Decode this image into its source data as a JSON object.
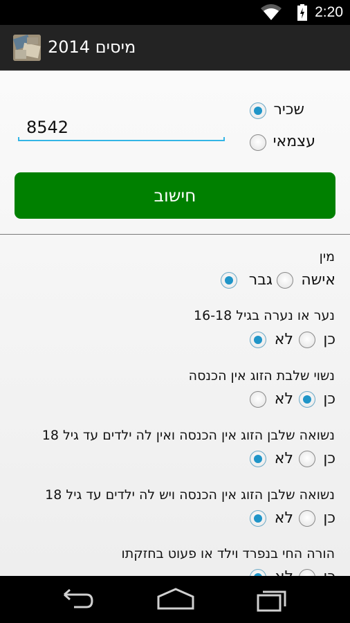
{
  "status_bar": {
    "time": "2:20"
  },
  "app": {
    "title": "מיסים 2014"
  },
  "form": {
    "salary_value": "8542",
    "employment_options": [
      {
        "label": "שכיר",
        "selected": true
      },
      {
        "label": "עצמאי",
        "selected": false
      }
    ],
    "calculate_label": "חישוב"
  },
  "questions": [
    {
      "label": "מין",
      "options": [
        {
          "label": "אישה",
          "selected": false
        },
        {
          "label": "גבר",
          "selected": true
        }
      ]
    },
    {
      "label": "נער או נערה בגיל 16-18",
      "options": [
        {
          "label": "כן",
          "selected": false
        },
        {
          "label": "לא",
          "selected": true
        }
      ]
    },
    {
      "label": "נשוי שלבת הזוג אין הכנסה",
      "options": [
        {
          "label": "כן",
          "selected": true
        },
        {
          "label": "לא",
          "selected": false
        }
      ]
    },
    {
      "label": "נשואה שלבן הזוג אין הכנסה ואין לה ילדים עד גיל 18",
      "options": [
        {
          "label": "כן",
          "selected": false
        },
        {
          "label": "לא",
          "selected": true
        }
      ]
    },
    {
      "label": "נשואה שלבן הזוג אין הכנסה ויש לה ילדים עד גיל 18",
      "options": [
        {
          "label": "כן",
          "selected": false
        },
        {
          "label": "לא",
          "selected": true
        }
      ]
    },
    {
      "label": "הורה החי בנפרד וילד או פעוט בחזקתו",
      "options": [
        {
          "label": "כן",
          "selected": false
        },
        {
          "label": "לא",
          "selected": true
        }
      ]
    }
  ],
  "icons": {
    "wifi": "wifi-icon",
    "battery": "battery-charging-icon",
    "back": "back-icon",
    "home": "home-icon",
    "recents": "recent-apps-icon"
  },
  "colors": {
    "button": "#008000",
    "accent": "#33b5e5",
    "radio_dot": "#1f95c8"
  }
}
